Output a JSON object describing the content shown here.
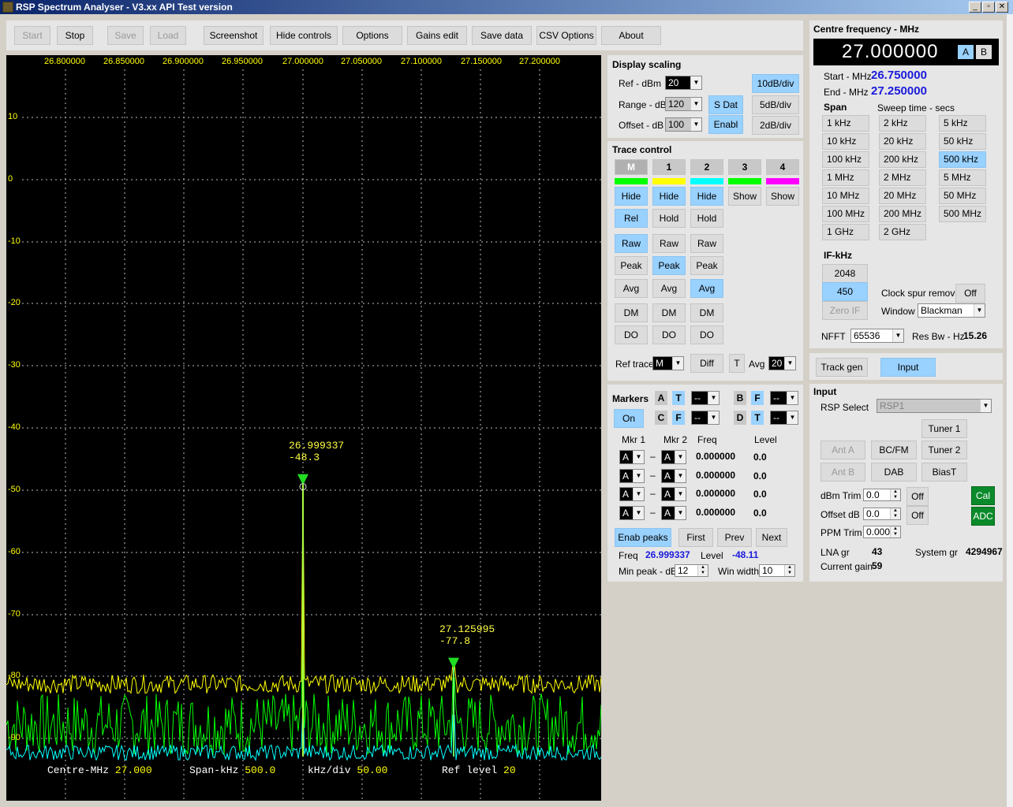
{
  "window": {
    "title": "RSP Spectrum Analyser - V3.xx API Test version",
    "min": "_",
    "max": "▫",
    "close": "✕"
  },
  "toolbar": {
    "start": "Start",
    "stop": "Stop",
    "save": "Save",
    "load": "Load",
    "screenshot": "Screenshot",
    "hide_controls": "Hide controls",
    "options": "Options",
    "gains_edit": "Gains edit",
    "save_data": "Save data",
    "csv_options": "CSV Options",
    "about": "About"
  },
  "plot": {
    "freq_ticks": [
      "26.800000",
      "26.850000",
      "26.900000",
      "26.950000",
      "27.000000",
      "27.050000",
      "27.100000",
      "27.150000",
      "27.200000"
    ],
    "level_ticks": [
      "10",
      "0",
      "-10",
      "-20",
      "-30",
      "-40",
      "-50",
      "-60",
      "-70",
      "-80",
      "-90"
    ],
    "marker1": {
      "freq": "26.999337",
      "level": "-48.3"
    },
    "marker2": {
      "freq": "27.125995",
      "level": "-77.8"
    },
    "status": {
      "centre_label": "Centre-MHz",
      "centre_value": "27.000",
      "span_label": "Span-kHz",
      "span_value": "500.0",
      "kdiv_label": "kHz/div",
      "kdiv_value": "50.00",
      "ref_label": "Ref level",
      "ref_value": "20"
    },
    "colors": {
      "bg": "#000000",
      "grid": "#c8c8c8",
      "label": "#ffff00",
      "trace_m": "#ffff00",
      "trace_1": "#00ff00",
      "trace_2": "#00ffff"
    }
  },
  "display_scaling": {
    "title": "Display scaling",
    "ref_label": "Ref - dBm",
    "ref_value": "20",
    "range_label": "Range - dB",
    "range_value": "120",
    "offset_label": "Offset - dB",
    "offset_value": "100",
    "sdat": "S Dat",
    "enabl": "Enabl",
    "div10": "10dB/div",
    "div5": "5dB/div",
    "div2": "2dB/div"
  },
  "trace_control": {
    "title": "Trace control",
    "headers": [
      "M",
      "1",
      "2",
      "3",
      "4"
    ],
    "colors": [
      "#00ff00",
      "#ffff00",
      "#00ffff",
      "#00ff00",
      "#ff00ff"
    ],
    "hide": [
      "Hide",
      "Hide",
      "Hide",
      "Show",
      "Show"
    ],
    "rel": "Rel",
    "hold": [
      "Hold",
      "Hold"
    ],
    "raw": [
      "Raw",
      "Raw",
      "Raw"
    ],
    "peak": [
      "Peak",
      "Peak",
      "Peak"
    ],
    "avg": [
      "Avg",
      "Avg",
      "Avg"
    ],
    "dm": [
      "DM",
      "DM",
      "DM"
    ],
    "do": [
      "DO",
      "DO",
      "DO"
    ],
    "ref_trace_label": "Ref trace",
    "ref_trace_value": "M",
    "diff": "Diff",
    "t": "T",
    "avg_label": "Avg",
    "avg_value": "20"
  },
  "markers": {
    "title": "Markers",
    "on": "On",
    "a": "A",
    "t": "T",
    "b": "B",
    "f": "F",
    "c": "C",
    "d": "D",
    "dash": "--",
    "mkr1": "Mkr 1",
    "mkr2": "Mkr 2",
    "freq": "Freq",
    "level": "Level",
    "rows": [
      {
        "m1": "A",
        "m2": "A",
        "freq": "0.000000",
        "level": "0.0"
      },
      {
        "m1": "A",
        "m2": "A",
        "freq": "0.000000",
        "level": "0.0"
      },
      {
        "m1": "A",
        "m2": "A",
        "freq": "0.000000",
        "level": "0.0"
      },
      {
        "m1": "A",
        "m2": "A",
        "freq": "0.000000",
        "level": "0.0"
      }
    ],
    "enab_peaks": "Enab peaks",
    "first": "First",
    "prev": "Prev",
    "next": "Next",
    "freq_label": "Freq",
    "freq_value": "26.999337",
    "level_label": "Level",
    "level_value": "-48.11",
    "min_peak_label": "Min peak - dB",
    "min_peak_value": "12",
    "win_width_label": "Win width",
    "win_width_value": "10"
  },
  "centre": {
    "title": "Centre frequency - MHz",
    "value": "27.000000",
    "a": "A",
    "b": "B",
    "start_label": "Start - MHz",
    "start_value": "26.750000",
    "end_label": "End - MHz",
    "end_value": "27.250000",
    "span_label": "Span",
    "sweep_label": "Sweep time - secs",
    "spans": [
      "1 kHz",
      "2 kHz",
      "5 kHz",
      "10 kHz",
      "20 kHz",
      "50 kHz",
      "100 kHz",
      "200 kHz",
      "500 kHz",
      "1 MHz",
      "2 MHz",
      "5 MHz",
      "10 MHz",
      "20 MHz",
      "50 MHz",
      "100 MHz",
      "200 MHz",
      "500 MHz",
      "1 GHz",
      "2 GHz"
    ],
    "if_label": "IF-kHz",
    "if1": "2048",
    "if2": "450",
    "zero_if": "Zero IF",
    "clock_label": "Clock spur removal",
    "clock_value": "Off",
    "window_label": "Window",
    "window_value": "Blackman",
    "nfft_label": "NFFT",
    "nfft_value": "65536",
    "resbw_label": "Res Bw - Hz",
    "resbw_value": "15.26"
  },
  "tabs": {
    "track_gen": "Track gen",
    "input": "Input"
  },
  "input": {
    "title": "Input",
    "rsp_label": "RSP Select",
    "rsp_value": "RSP1",
    "tuner1": "Tuner 1",
    "ant_a": "Ant A",
    "bcfm": "BC/FM",
    "tuner2": "Tuner 2",
    "ant_b": "Ant B",
    "dab": "DAB",
    "biast": "BiasT",
    "dbm_trim_label": "dBm Trim",
    "dbm_trim_value": "0.0",
    "off1": "Off",
    "cal": "Cal",
    "offset_label": "Offset dB",
    "offset_value": "0.0",
    "off2": "Off",
    "adc": "ADC",
    "ppm_label": "PPM Trim",
    "ppm_value": "0.000",
    "lna_label": "LNA gr",
    "lna_value": "43",
    "system_label": "System gr",
    "system_value": "4294967",
    "current_label": "Current gain",
    "current_value": "59"
  }
}
